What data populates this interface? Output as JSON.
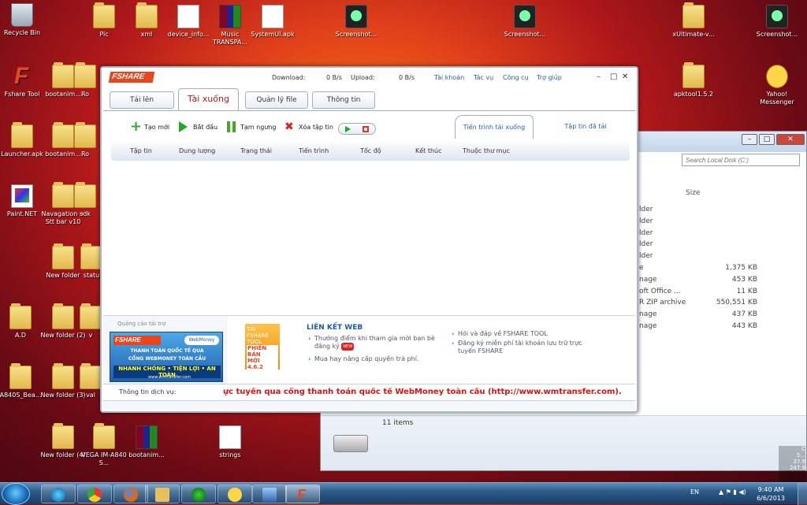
{
  "desktop": {
    "icons": [
      {
        "label": "Recycle Bin",
        "type": "bin"
      },
      {
        "label": "Pic",
        "type": "folder"
      },
      {
        "label": "xml",
        "type": "folder"
      },
      {
        "label": "device_info...",
        "type": "doc"
      },
      {
        "label": "Music TRANSPA...",
        "type": "rar"
      },
      {
        "label": "SystemUI.apk",
        "type": "doc"
      },
      {
        "label": "Screenshot...",
        "type": "phone"
      },
      {
        "label": "Screenshot...",
        "type": "phone"
      },
      {
        "label": "xUltimate-v...",
        "type": "folder"
      },
      {
        "label": "Screenshot...",
        "type": "phone"
      },
      {
        "label": "Fshare Tool",
        "type": "fshare"
      },
      {
        "label": "bootanim...",
        "type": "folder"
      },
      {
        "label": "Ro",
        "type": "folder"
      },
      {
        "label": "apktool1.5.2",
        "type": "folder"
      },
      {
        "label": "Yahoo! Messenger",
        "type": "yahoo"
      },
      {
        "label": "Launcher.apk",
        "type": "folder"
      },
      {
        "label": "bootanim...",
        "type": "folder"
      },
      {
        "label": "Ro",
        "type": "folder"
      },
      {
        "label": "Paint.NET",
        "type": "paint"
      },
      {
        "label": "Navagation + Stt bar v10",
        "type": "folder"
      },
      {
        "label": "sdk",
        "type": "folder"
      },
      {
        "label": "New folder",
        "type": "folder"
      },
      {
        "label": "statu",
        "type": "folder"
      },
      {
        "label": "A.D",
        "type": "folder"
      },
      {
        "label": "New folder (2)",
        "type": "folder"
      },
      {
        "label": "v",
        "type": "folder"
      },
      {
        "label": "A840S_Bea...",
        "type": "folder"
      },
      {
        "label": "New folder (3)",
        "type": "folder"
      },
      {
        "label": "val",
        "type": "folder"
      },
      {
        "label": "New folder (4)",
        "type": "folder"
      },
      {
        "label": "VEGA IM-A840 S...",
        "type": "folder"
      },
      {
        "label": "bootanim...",
        "type": "rar"
      },
      {
        "label": "strings",
        "type": "doc"
      }
    ]
  },
  "explorer": {
    "search_placeholder": "Search Local Disk (C:)",
    "size_header": "Size",
    "rows": [
      {
        "type": "lder",
        "size": ""
      },
      {
        "type": "lder",
        "size": ""
      },
      {
        "type": "lder",
        "size": ""
      },
      {
        "type": "lder",
        "size": ""
      },
      {
        "type": "lder",
        "size": ""
      },
      {
        "type": "e",
        "size": "1,375 KB"
      },
      {
        "type": "nage",
        "size": "453 KB"
      },
      {
        "type": "oft Office ...",
        "size": "11 KB"
      },
      {
        "type": "R ZIP archive",
        "size": "550,551 KB"
      },
      {
        "type": "nage",
        "size": "437 KB"
      },
      {
        "type": "nage",
        "size": "443 KB"
      }
    ],
    "item_count": "11 items"
  },
  "fshare": {
    "logo": "FSHARE",
    "download_label": "Download:",
    "download_value": "0 B/s",
    "upload_label": "Upload:",
    "upload_value": "0 B/s",
    "menu": [
      "Tài khoản",
      "Tác vụ",
      "Công cụ",
      "Trợ giúp"
    ],
    "tabs": [
      "Tải lên",
      "Tài xuống",
      "Quản lý file",
      "Thông tin"
    ],
    "toolbar": {
      "new": "Tạo mới",
      "start": "Bắt đầu",
      "pause": "Tạm ngưng",
      "delete": "Xóa tập tin"
    },
    "subtabs": [
      "Tiến trình tải xuống",
      "Tập tin đã tải"
    ],
    "columns": [
      "Tập tin",
      "Dung lượng",
      "Trạng thái",
      "Tiến trình",
      "Tốc độ",
      "Kết thúc",
      "Thuộc thư mục"
    ],
    "ad_label": "Quảng cáo tài trợ",
    "banner": {
      "logo": "FSHARE",
      "wm": "WebMoney",
      "line1": "THANH TOÁN QUỐC TẾ QUA",
      "line2": "CỔNG WEBMONEY TOÀN CẦU",
      "line3": "NHANH CHÓNG • TIỆN LỢI • AN TOÀN",
      "line4": "www.wmtransfer.com"
    },
    "promo": {
      "l1": "TẢI",
      "l2": "FSHARE",
      "l3": "TOOL",
      "l4": "PHIÊN BẢN",
      "l5": "MỚI 4.6.2"
    },
    "links_title": "LIÊN KẾT WEB",
    "links_left": [
      "Thưởng điểm khi tham gia mời bạn bè đăng ký",
      "Mua hay nâng cấp quyền trả phí."
    ],
    "new_badge": "NEW",
    "links_right": [
      "Hỏi và đáp về FSHARE TOOL",
      "Đăng ký miễn phí tài khoản lưu trữ trực tuyến FSHARE"
    ],
    "service_label": "Thông tin dịch vụ:",
    "service_text": "ực tuyến qua cổng thanh toán quốc tế WebMoney toàn cầu (http://www.wmtransfer.com)."
  },
  "taskbar": {
    "lang": "EN",
    "time": "9:40 AM",
    "date": "6/6/2013"
  },
  "gadget": {
    "l1": "C",
    "l2": "5...",
    "l3": "37.9",
    "l4": "247.9"
  }
}
